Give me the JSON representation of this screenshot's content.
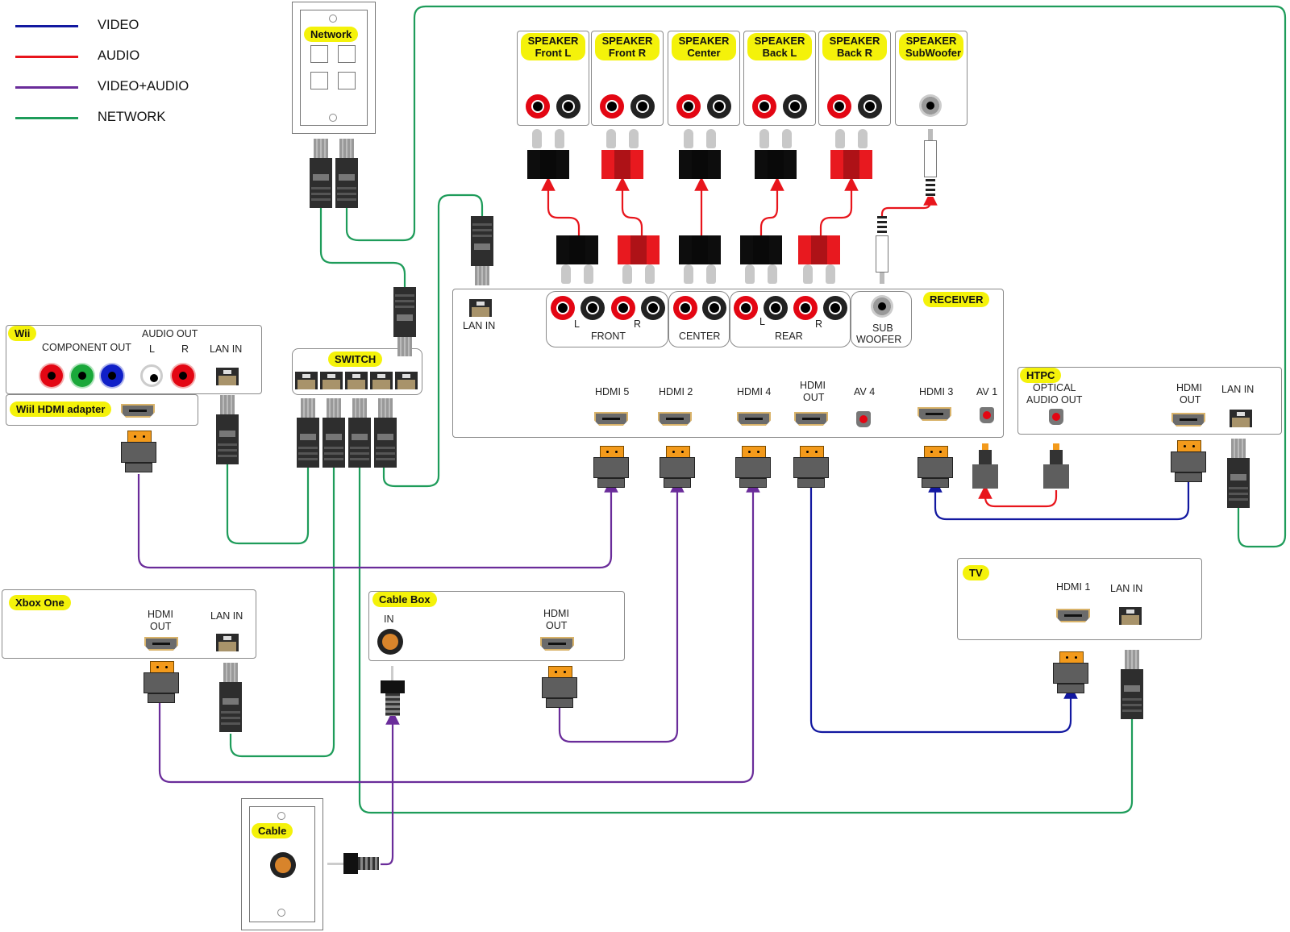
{
  "legend": [
    {
      "label": "VIDEO",
      "color": "#1218a0"
    },
    {
      "label": "AUDIO",
      "color": "#e8151c"
    },
    {
      "label": "VIDEO+AUDIO",
      "color": "#6a2c9a"
    },
    {
      "label": "NETWORK",
      "color": "#1e9c5a"
    }
  ],
  "colors": {
    "tag": "#f4f20a",
    "video": "#1218a0",
    "audio": "#e8151c",
    "video_audio": "#6a2c9a",
    "network": "#1e9c5a"
  },
  "network_plate": {
    "label": "Network"
  },
  "cable_plate": {
    "label": "Cable"
  },
  "speakers": [
    {
      "line1": "SPEAKER",
      "line2": "Front L",
      "terminal": "black"
    },
    {
      "line1": "SPEAKER",
      "line2": "Front R",
      "terminal": "red"
    },
    {
      "line1": "SPEAKER",
      "line2": "Center",
      "terminal": "black"
    },
    {
      "line1": "SPEAKER",
      "line2": "Back L",
      "terminal": "black"
    },
    {
      "line1": "SPEAKER",
      "line2": "Back R",
      "terminal": "red"
    },
    {
      "line1": "SPEAKER",
      "line2": "SubWoofer",
      "terminal": "rca"
    }
  ],
  "receiver": {
    "label": "RECEIVER",
    "lan_in": "LAN IN",
    "front": {
      "label": "FRONT",
      "l": "L",
      "r": "R"
    },
    "center": {
      "label": "CENTER"
    },
    "rear": {
      "label": "REAR",
      "l": "L",
      "r": "R"
    },
    "sub": {
      "line1": "SUB",
      "line2": "WOOFER"
    },
    "ports": [
      {
        "label": "HDMI 5"
      },
      {
        "label": "HDMI 2"
      },
      {
        "label": "HDMI 4"
      },
      {
        "label": "HDMI\nOUT",
        "line1": "HDMI",
        "line2": "OUT"
      },
      {
        "label": "AV 4"
      },
      {
        "label": "HDMI 3"
      },
      {
        "label": "AV 1"
      }
    ]
  },
  "htpc": {
    "label": "HTPC",
    "optical_1": "OPTICAL",
    "optical_2": "AUDIO OUT",
    "hdmi_1": "HDMI",
    "hdmi_2": "OUT",
    "lan": "LAN IN"
  },
  "wii": {
    "label": "Wii",
    "component": "COMPONENT OUT",
    "audio_out": "AUDIO OUT",
    "l": "L",
    "r": "R",
    "lan": "LAN IN"
  },
  "wii_hdmi": {
    "label": "Wiil HDMI adapter"
  },
  "switch": {
    "label": "SWITCH",
    "ports": 5
  },
  "xbox": {
    "label": "Xbox One",
    "hdmi_1": "HDMI",
    "hdmi_2": "OUT",
    "lan": "LAN IN"
  },
  "cable_box": {
    "label": "Cable Box",
    "in": "IN",
    "hdmi_1": "HDMI",
    "hdmi_2": "OUT"
  },
  "tv": {
    "label": "TV",
    "hdmi": "HDMI 1",
    "lan": "LAN IN"
  }
}
